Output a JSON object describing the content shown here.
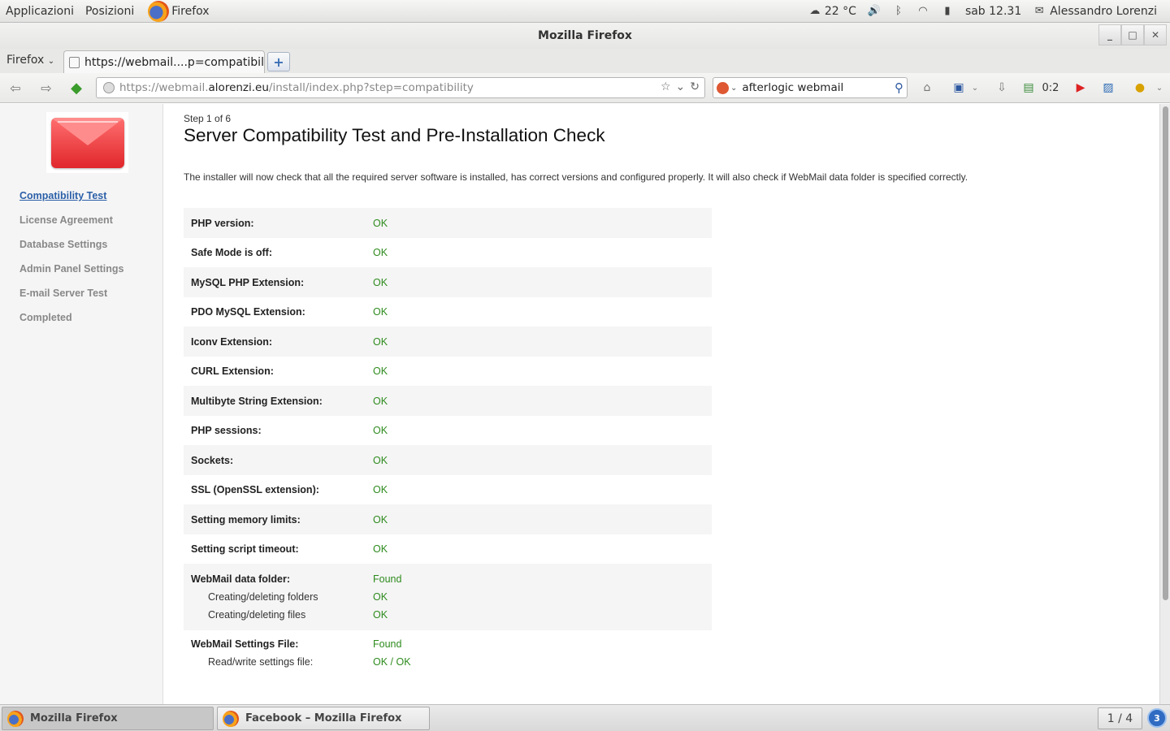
{
  "topbar": {
    "applications": "Applicazioni",
    "places": "Posizioni",
    "active_app": "Firefox",
    "weather": "22 °C",
    "clock": "sab 12.31",
    "user": "Alessandro Lorenzi"
  },
  "window": {
    "title": "Mozilla Firefox"
  },
  "tabs": {
    "firefox_menu": "Firefox",
    "active_tab_title": "https://webmail....p=compatibility",
    "new_tab": "+"
  },
  "navbar": {
    "url_prefix": "https://webmail.",
    "url_domain": "alorenzi.eu",
    "url_path": "/install/index.php?step=compatibility",
    "search_value": "afterlogic webmail",
    "counter": "0:2"
  },
  "sidebar": {
    "steps": [
      {
        "label": "Compatibility Test",
        "active": true
      },
      {
        "label": "License Agreement",
        "active": false
      },
      {
        "label": "Database Settings",
        "active": false
      },
      {
        "label": "Admin Panel Settings",
        "active": false
      },
      {
        "label": "E-mail Server Test",
        "active": false
      },
      {
        "label": "Completed",
        "active": false
      }
    ]
  },
  "main": {
    "step_number": "Step 1 of 6",
    "heading": "Server Compatibility Test and Pre-Installation Check",
    "intro": "The installer will now check that all the required server software is installed, has correct versions and configured properly. It will also check if WebMail data folder is specified correctly.",
    "checks": [
      {
        "label": "PHP version:",
        "value": "OK"
      },
      {
        "label": "Safe Mode is off:",
        "value": "OK"
      },
      {
        "label": "MySQL PHP Extension:",
        "value": "OK"
      },
      {
        "label": "PDO MySQL Extension:",
        "value": "OK"
      },
      {
        "label": "Iconv Extension:",
        "value": "OK"
      },
      {
        "label": "CURL Extension:",
        "value": "OK"
      },
      {
        "label": "Multibyte String Extension:",
        "value": "OK"
      },
      {
        "label": "PHP sessions:",
        "value": "OK"
      },
      {
        "label": "Sockets:",
        "value": "OK"
      },
      {
        "label": "SSL (OpenSSL extension):",
        "value": "OK"
      },
      {
        "label": "Setting memory limits:",
        "value": "OK"
      },
      {
        "label": "Setting script timeout:",
        "value": "OK"
      },
      {
        "label": "WebMail data folder:",
        "value": "Found",
        "sub": [
          {
            "label": "Creating/deleting folders",
            "value": "OK"
          },
          {
            "label": "Creating/deleting files",
            "value": "OK"
          }
        ]
      },
      {
        "label": "WebMail Settings File:",
        "value": "Found",
        "sub": [
          {
            "label": "Read/write settings file:",
            "value": "OK / OK"
          }
        ]
      }
    ]
  },
  "taskbar": {
    "tasks": [
      {
        "label": "Mozilla Firefox",
        "active": true
      },
      {
        "label": "Facebook – Mozilla Firefox",
        "active": false
      }
    ],
    "workspace": "1 / 4",
    "notifications": "3"
  }
}
